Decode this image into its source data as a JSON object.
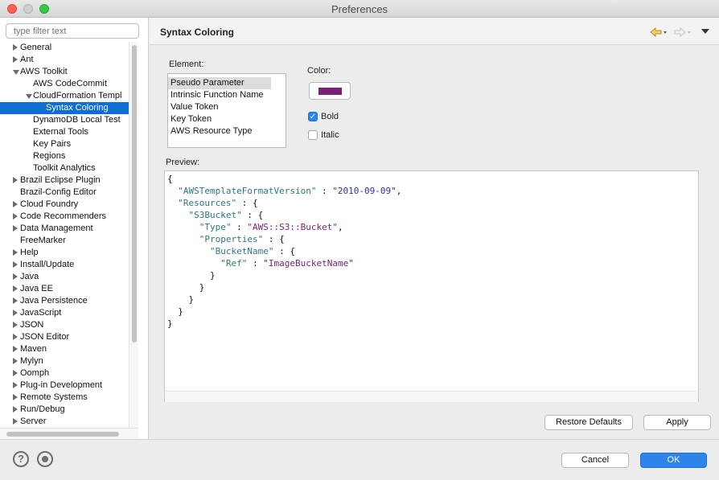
{
  "window": {
    "title": "Preferences"
  },
  "filter": {
    "placeholder": "type filter text"
  },
  "tree": [
    {
      "label": "General",
      "level": 0,
      "arrow": "right"
    },
    {
      "label": "Ant",
      "level": 0,
      "arrow": "right"
    },
    {
      "label": "AWS Toolkit",
      "level": 0,
      "arrow": "down"
    },
    {
      "label": "AWS CodeCommit",
      "level": 1,
      "arrow": "none"
    },
    {
      "label": "CloudFormation Templ",
      "level": 1,
      "arrow": "down"
    },
    {
      "label": "Syntax Coloring",
      "level": 2,
      "arrow": "none",
      "selected": true
    },
    {
      "label": "DynamoDB Local Test",
      "level": 1,
      "arrow": "none"
    },
    {
      "label": "External Tools",
      "level": 1,
      "arrow": "none"
    },
    {
      "label": "Key Pairs",
      "level": 1,
      "arrow": "none"
    },
    {
      "label": "Regions",
      "level": 1,
      "arrow": "none"
    },
    {
      "label": "Toolkit Analytics",
      "level": 1,
      "arrow": "none"
    },
    {
      "label": "Brazil Eclipse Plugin",
      "level": 0,
      "arrow": "right"
    },
    {
      "label": "Brazil-Config Editor",
      "level": 0,
      "arrow": "none"
    },
    {
      "label": "Cloud Foundry",
      "level": 0,
      "arrow": "right"
    },
    {
      "label": "Code Recommenders",
      "level": 0,
      "arrow": "right"
    },
    {
      "label": "Data Management",
      "level": 0,
      "arrow": "right"
    },
    {
      "label": "FreeMarker",
      "level": 0,
      "arrow": "none"
    },
    {
      "label": "Help",
      "level": 0,
      "arrow": "right"
    },
    {
      "label": "Install/Update",
      "level": 0,
      "arrow": "right"
    },
    {
      "label": "Java",
      "level": 0,
      "arrow": "right"
    },
    {
      "label": "Java EE",
      "level": 0,
      "arrow": "right"
    },
    {
      "label": "Java Persistence",
      "level": 0,
      "arrow": "right"
    },
    {
      "label": "JavaScript",
      "level": 0,
      "arrow": "right"
    },
    {
      "label": "JSON",
      "level": 0,
      "arrow": "right"
    },
    {
      "label": "JSON Editor",
      "level": 0,
      "arrow": "right"
    },
    {
      "label": "Maven",
      "level": 0,
      "arrow": "right"
    },
    {
      "label": "Mylyn",
      "level": 0,
      "arrow": "right"
    },
    {
      "label": "Oomph",
      "level": 0,
      "arrow": "right"
    },
    {
      "label": "Plug-in Development",
      "level": 0,
      "arrow": "right"
    },
    {
      "label": "Remote Systems",
      "level": 0,
      "arrow": "right"
    },
    {
      "label": "Run/Debug",
      "level": 0,
      "arrow": "right"
    },
    {
      "label": "Server",
      "level": 0,
      "arrow": "right"
    }
  ],
  "page": {
    "title": "Syntax Coloring",
    "back_icon": "back-arrow-icon",
    "forward_icon": "forward-arrow-icon",
    "menu_icon": "view-menu-icon",
    "element_label": "Element:",
    "elements": [
      {
        "label": "Pseudo Parameter",
        "selected": true
      },
      {
        "label": "Intrinsic Function Name"
      },
      {
        "label": "Value Token"
      },
      {
        "label": "Key Token"
      },
      {
        "label": "AWS Resource Type"
      }
    ],
    "color_label": "Color:",
    "color_value": "#7a1f7a",
    "bold_label": "Bold",
    "bold_checked": true,
    "italic_label": "Italic",
    "italic_checked": false,
    "preview_label": "Preview:",
    "restore_label": "Restore Defaults",
    "apply_label": "Apply"
  },
  "preview_lines": [
    [
      [
        "{",
        "p"
      ]
    ],
    [
      [
        "  ",
        "p"
      ],
      [
        "\"AWSTemplateFormatVersion\"",
        "k"
      ],
      [
        " : ",
        "p"
      ],
      [
        "\"2010-09-09\"",
        "s"
      ],
      [
        ",",
        "p"
      ]
    ],
    [
      [
        "  ",
        "p"
      ],
      [
        "\"Resources\"",
        "k"
      ],
      [
        " : {",
        "p"
      ]
    ],
    [
      [
        "    ",
        "p"
      ],
      [
        "\"S3Bucket\"",
        "k"
      ],
      [
        " : {",
        "p"
      ]
    ],
    [
      [
        "      ",
        "p"
      ],
      [
        "\"Type\"",
        "k"
      ],
      [
        " : ",
        "p"
      ],
      [
        "\"AWS::S3::Bucket\"",
        "v"
      ],
      [
        ",",
        "p"
      ]
    ],
    [
      [
        "      ",
        "p"
      ],
      [
        "\"Properties\"",
        "k"
      ],
      [
        " : {",
        "p"
      ]
    ],
    [
      [
        "        ",
        "p"
      ],
      [
        "\"BucketName\"",
        "k"
      ],
      [
        " : {",
        "p"
      ]
    ],
    [
      [
        "          ",
        "p"
      ],
      [
        "\"Ref\"",
        "k"
      ],
      [
        " : ",
        "p"
      ],
      [
        "\"ImageBucketName\"",
        "v"
      ]
    ],
    [
      [
        "        }",
        "p"
      ]
    ],
    [
      [
        "      }",
        "p"
      ]
    ],
    [
      [
        "    }",
        "p"
      ]
    ],
    [
      [
        "  }",
        "p"
      ]
    ],
    [
      [
        "}",
        "p"
      ]
    ]
  ],
  "footer": {
    "help_icon": "help-icon",
    "import_icon": "import-export-icon",
    "cancel_label": "Cancel",
    "ok_label": "OK"
  }
}
